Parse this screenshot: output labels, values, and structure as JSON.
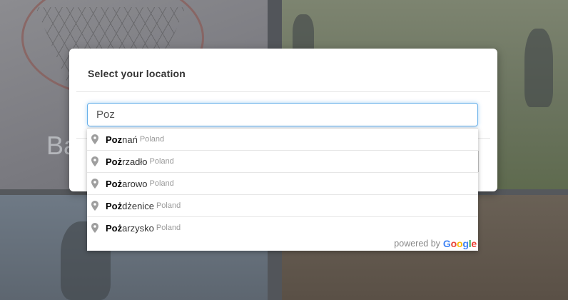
{
  "background": {
    "ghost_text": "Ba"
  },
  "modal": {
    "title": "Select your location"
  },
  "search": {
    "value": "Poz"
  },
  "suggestions": [
    {
      "match": "Poz",
      "rest": "nań",
      "secondary": "Poland"
    },
    {
      "match": "Poż",
      "rest": "rzadło",
      "secondary": "Poland"
    },
    {
      "match": "Poż",
      "rest": "arowo",
      "secondary": "Poland"
    },
    {
      "match": "Poż",
      "rest": "dżenice",
      "secondary": "Poland"
    },
    {
      "match": "Poż",
      "rest": "arzysko",
      "secondary": "Poland"
    }
  ],
  "attribution": {
    "powered_by": "powered by",
    "brand": "Google",
    "brand_colors": [
      "#4285F4",
      "#EA4335",
      "#FBBC05",
      "#4285F4",
      "#34A853",
      "#EA4335"
    ]
  },
  "icons": {
    "suggestion_icon": "map-pin-icon"
  },
  "colors": {
    "focus_border": "#66afe9",
    "pin": "#9e9e9e"
  }
}
